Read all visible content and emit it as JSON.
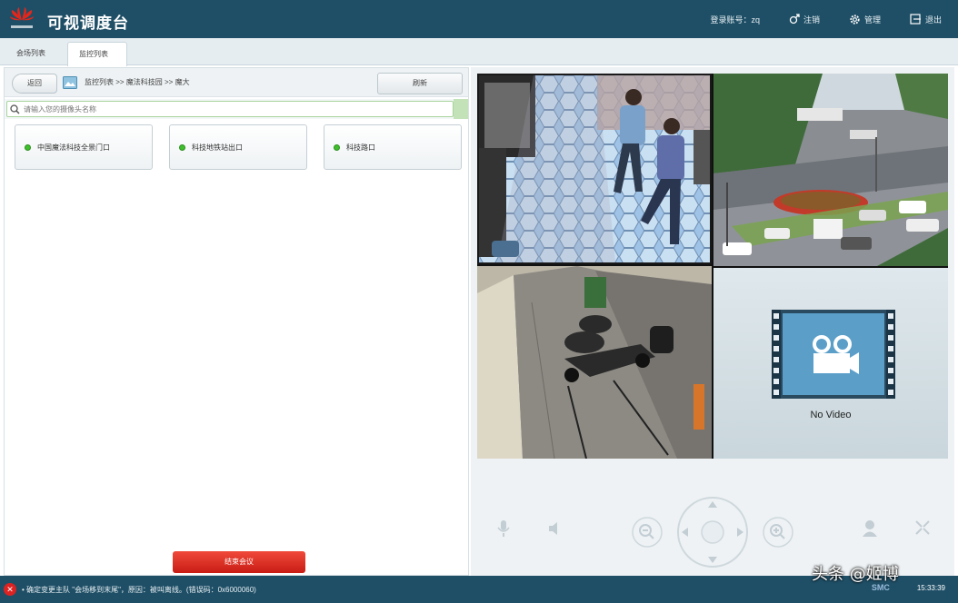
{
  "app": {
    "title": "可视调度台",
    "logo": "huawei-logo"
  },
  "titlebar": {
    "account_label": "登录账号：zq",
    "logout_label": "注销",
    "settings_label": "管理",
    "exit_label": "退出"
  },
  "tabs": [
    {
      "label": "会场列表"
    },
    {
      "label": "监控列表"
    }
  ],
  "nav": {
    "back_label": "返回",
    "breadcrumb": "监控列表  >>  魔法科技园  >>  魔大",
    "refresh_label": "刷新"
  },
  "search": {
    "placeholder": "请输入您的摄像头名称"
  },
  "cameras": [
    {
      "label": "中国魔法科技全景门口",
      "status_color": "#3fbf2b"
    },
    {
      "label": "科技地铁站出口",
      "status_color": "#3fbf2b"
    },
    {
      "label": "科技路口",
      "status_color": "#3fbf2b"
    }
  ],
  "start_conference_label": "结束会议",
  "video": {
    "no_video_text": "No Video"
  },
  "status": {
    "message": "• 确定变更主队 \"会场移到末尾\"，原因：被叫离线。(错误码：0x6000060)",
    "badge": "SMC",
    "clock": "15:33:39"
  },
  "watermark": "头条 @姬博"
}
